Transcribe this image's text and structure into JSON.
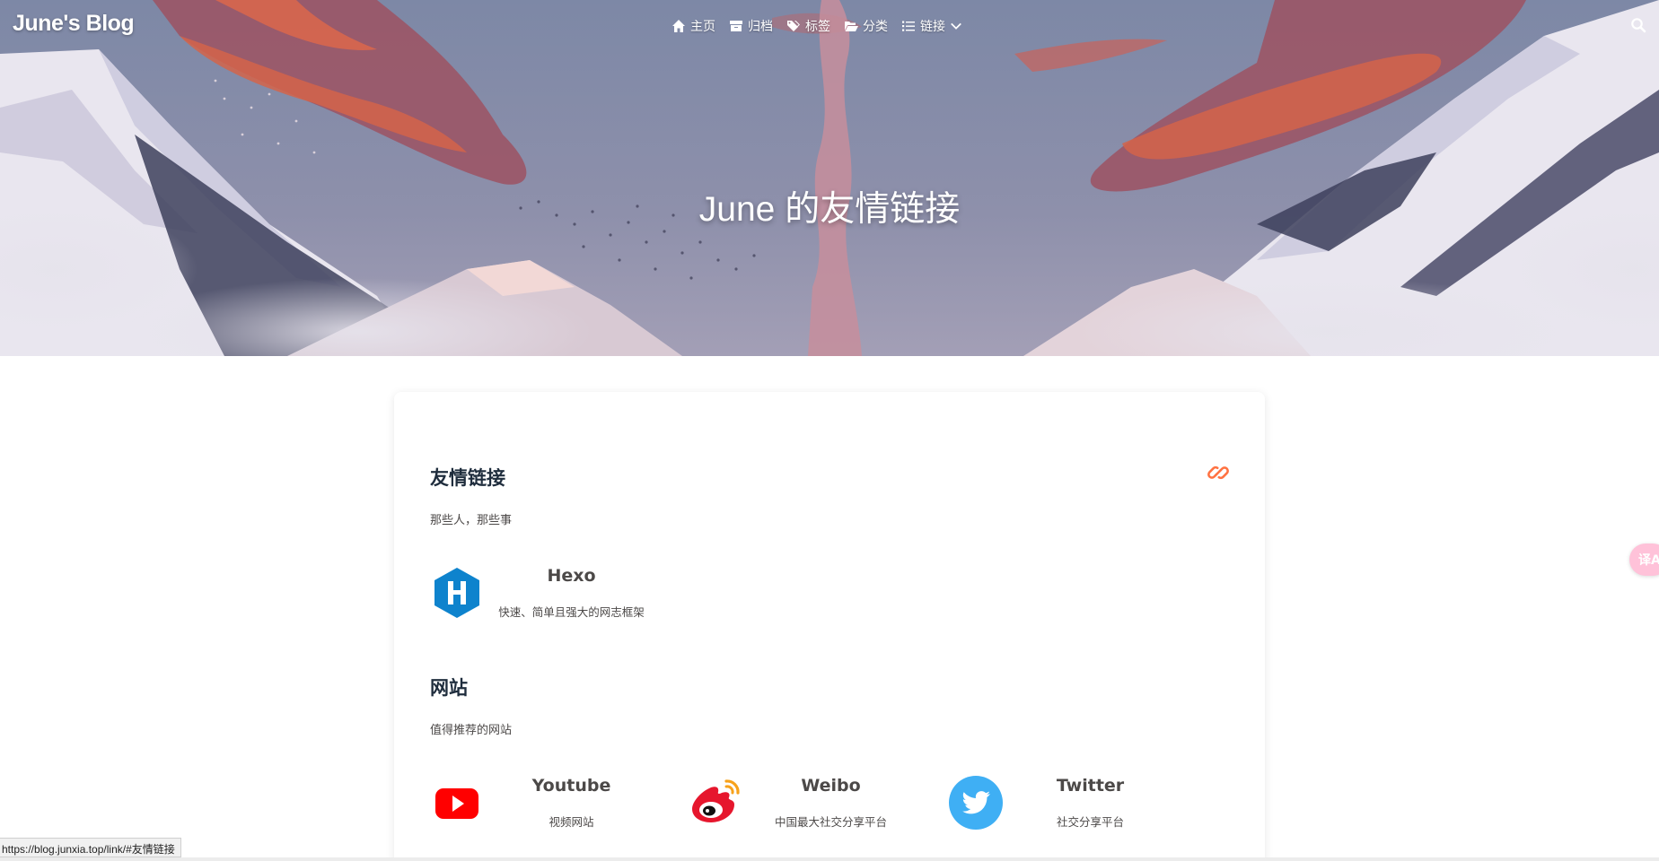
{
  "brand": "June's Blog",
  "nav": {
    "items": [
      {
        "icon": "home-icon",
        "label": "主页"
      },
      {
        "icon": "archive-icon",
        "label": "归档"
      },
      {
        "icon": "tags-icon",
        "label": "标签"
      },
      {
        "icon": "folder-open-icon",
        "label": "分类"
      },
      {
        "icon": "list-icon",
        "label": "链接"
      }
    ],
    "search_icon": "search-icon"
  },
  "hero": {
    "title": "June 的友情链接"
  },
  "friends": {
    "title": "友情链接",
    "desc": "那些人，那些事",
    "items": [
      {
        "name": "Hexo",
        "desc": "快速、简单且强大的网志框架",
        "icon": "hexo-logo"
      }
    ]
  },
  "websites": {
    "title": "网站",
    "desc": "值得推荐的网站",
    "items": [
      {
        "name": "Youtube",
        "desc": "视频网站",
        "icon": "youtube-logo"
      },
      {
        "name": "Weibo",
        "desc": "中国最大社交分享平台",
        "icon": "weibo-logo"
      },
      {
        "name": "Twitter",
        "desc": "社交分享平台",
        "icon": "twitter-logo"
      }
    ]
  },
  "side_button": {
    "label": "译A"
  },
  "status": {
    "url": "https://blog.junxia.top/link/#友情链接"
  },
  "colors": {
    "accent": "#ff7242",
    "title": "#1f2d3d",
    "text": "#4c4948"
  }
}
